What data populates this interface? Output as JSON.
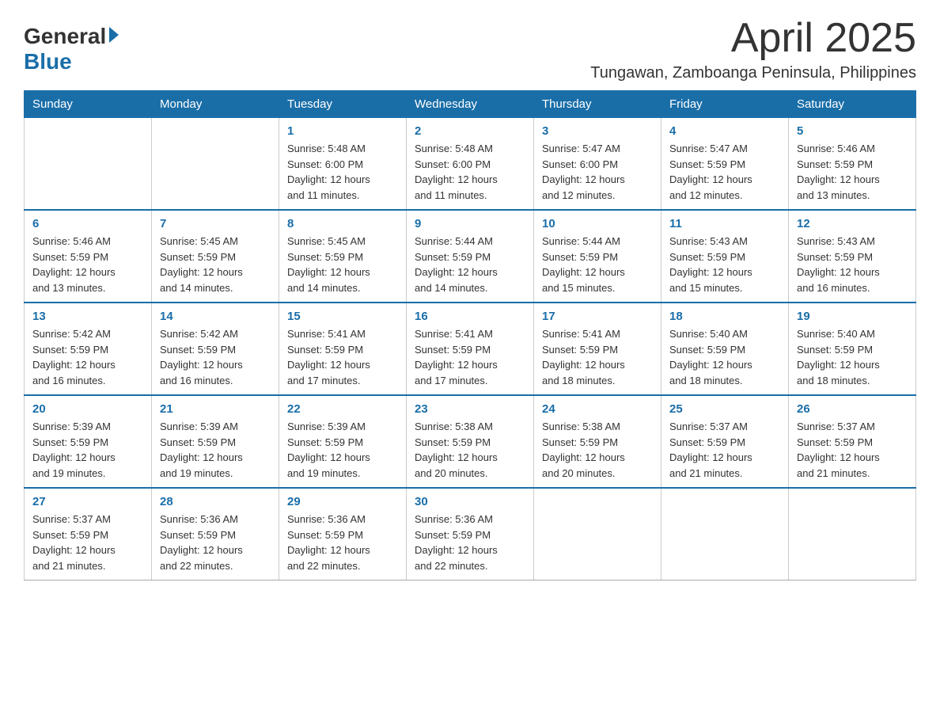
{
  "logo": {
    "general": "General",
    "blue": "Blue"
  },
  "title": "April 2025",
  "subtitle": "Tungawan, Zamboanga Peninsula, Philippines",
  "weekdays": [
    "Sunday",
    "Monday",
    "Tuesday",
    "Wednesday",
    "Thursday",
    "Friday",
    "Saturday"
  ],
  "weeks": [
    [
      {
        "day": "",
        "info": ""
      },
      {
        "day": "",
        "info": ""
      },
      {
        "day": "1",
        "info": "Sunrise: 5:48 AM\nSunset: 6:00 PM\nDaylight: 12 hours\nand 11 minutes."
      },
      {
        "day": "2",
        "info": "Sunrise: 5:48 AM\nSunset: 6:00 PM\nDaylight: 12 hours\nand 11 minutes."
      },
      {
        "day": "3",
        "info": "Sunrise: 5:47 AM\nSunset: 6:00 PM\nDaylight: 12 hours\nand 12 minutes."
      },
      {
        "day": "4",
        "info": "Sunrise: 5:47 AM\nSunset: 5:59 PM\nDaylight: 12 hours\nand 12 minutes."
      },
      {
        "day": "5",
        "info": "Sunrise: 5:46 AM\nSunset: 5:59 PM\nDaylight: 12 hours\nand 13 minutes."
      }
    ],
    [
      {
        "day": "6",
        "info": "Sunrise: 5:46 AM\nSunset: 5:59 PM\nDaylight: 12 hours\nand 13 minutes."
      },
      {
        "day": "7",
        "info": "Sunrise: 5:45 AM\nSunset: 5:59 PM\nDaylight: 12 hours\nand 14 minutes."
      },
      {
        "day": "8",
        "info": "Sunrise: 5:45 AM\nSunset: 5:59 PM\nDaylight: 12 hours\nand 14 minutes."
      },
      {
        "day": "9",
        "info": "Sunrise: 5:44 AM\nSunset: 5:59 PM\nDaylight: 12 hours\nand 14 minutes."
      },
      {
        "day": "10",
        "info": "Sunrise: 5:44 AM\nSunset: 5:59 PM\nDaylight: 12 hours\nand 15 minutes."
      },
      {
        "day": "11",
        "info": "Sunrise: 5:43 AM\nSunset: 5:59 PM\nDaylight: 12 hours\nand 15 minutes."
      },
      {
        "day": "12",
        "info": "Sunrise: 5:43 AM\nSunset: 5:59 PM\nDaylight: 12 hours\nand 16 minutes."
      }
    ],
    [
      {
        "day": "13",
        "info": "Sunrise: 5:42 AM\nSunset: 5:59 PM\nDaylight: 12 hours\nand 16 minutes."
      },
      {
        "day": "14",
        "info": "Sunrise: 5:42 AM\nSunset: 5:59 PM\nDaylight: 12 hours\nand 16 minutes."
      },
      {
        "day": "15",
        "info": "Sunrise: 5:41 AM\nSunset: 5:59 PM\nDaylight: 12 hours\nand 17 minutes."
      },
      {
        "day": "16",
        "info": "Sunrise: 5:41 AM\nSunset: 5:59 PM\nDaylight: 12 hours\nand 17 minutes."
      },
      {
        "day": "17",
        "info": "Sunrise: 5:41 AM\nSunset: 5:59 PM\nDaylight: 12 hours\nand 18 minutes."
      },
      {
        "day": "18",
        "info": "Sunrise: 5:40 AM\nSunset: 5:59 PM\nDaylight: 12 hours\nand 18 minutes."
      },
      {
        "day": "19",
        "info": "Sunrise: 5:40 AM\nSunset: 5:59 PM\nDaylight: 12 hours\nand 18 minutes."
      }
    ],
    [
      {
        "day": "20",
        "info": "Sunrise: 5:39 AM\nSunset: 5:59 PM\nDaylight: 12 hours\nand 19 minutes."
      },
      {
        "day": "21",
        "info": "Sunrise: 5:39 AM\nSunset: 5:59 PM\nDaylight: 12 hours\nand 19 minutes."
      },
      {
        "day": "22",
        "info": "Sunrise: 5:39 AM\nSunset: 5:59 PM\nDaylight: 12 hours\nand 19 minutes."
      },
      {
        "day": "23",
        "info": "Sunrise: 5:38 AM\nSunset: 5:59 PM\nDaylight: 12 hours\nand 20 minutes."
      },
      {
        "day": "24",
        "info": "Sunrise: 5:38 AM\nSunset: 5:59 PM\nDaylight: 12 hours\nand 20 minutes."
      },
      {
        "day": "25",
        "info": "Sunrise: 5:37 AM\nSunset: 5:59 PM\nDaylight: 12 hours\nand 21 minutes."
      },
      {
        "day": "26",
        "info": "Sunrise: 5:37 AM\nSunset: 5:59 PM\nDaylight: 12 hours\nand 21 minutes."
      }
    ],
    [
      {
        "day": "27",
        "info": "Sunrise: 5:37 AM\nSunset: 5:59 PM\nDaylight: 12 hours\nand 21 minutes."
      },
      {
        "day": "28",
        "info": "Sunrise: 5:36 AM\nSunset: 5:59 PM\nDaylight: 12 hours\nand 22 minutes."
      },
      {
        "day": "29",
        "info": "Sunrise: 5:36 AM\nSunset: 5:59 PM\nDaylight: 12 hours\nand 22 minutes."
      },
      {
        "day": "30",
        "info": "Sunrise: 5:36 AM\nSunset: 5:59 PM\nDaylight: 12 hours\nand 22 minutes."
      },
      {
        "day": "",
        "info": ""
      },
      {
        "day": "",
        "info": ""
      },
      {
        "day": "",
        "info": ""
      }
    ]
  ]
}
